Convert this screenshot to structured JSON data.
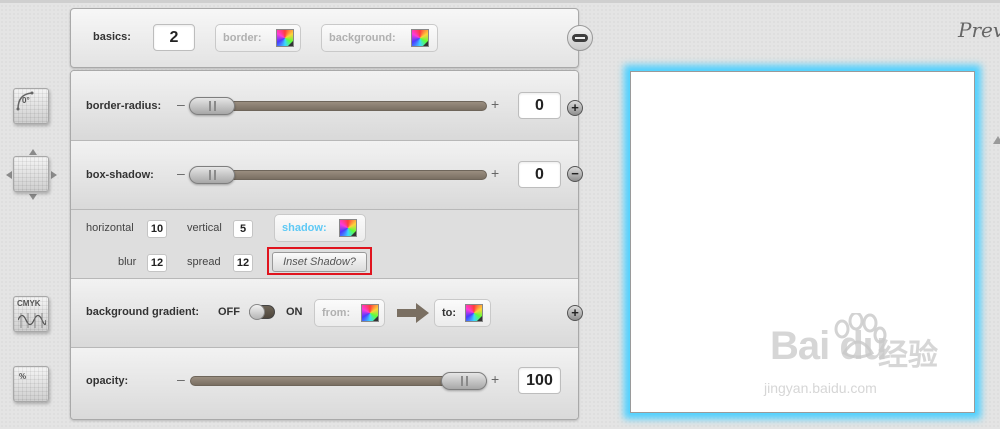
{
  "basics": {
    "label": "basics:",
    "value": "2",
    "border_label": "border:",
    "background_label": "background:"
  },
  "border_radius": {
    "label": "border-radius:",
    "minus": "–",
    "plus": "+",
    "value": "0",
    "slider_level": 0
  },
  "box_shadow": {
    "label": "box-shadow:",
    "minus": "–",
    "plus": "+",
    "value": "0",
    "slider_level": 0
  },
  "shadow_options": {
    "horizontal_label": "horizontal",
    "horizontal_value": "10",
    "vertical_label": "vertical",
    "vertical_value": "5",
    "shadow_label": "shadow:",
    "blur_label": "blur",
    "blur_value": "12",
    "spread_label": "spread",
    "spread_value": "12",
    "inset_button": "Inset Shadow?"
  },
  "background_gradient": {
    "label": "background gradient:",
    "off_label": "OFF",
    "on_label": "ON",
    "from_label": "from:",
    "to_label": "to:"
  },
  "opacity": {
    "label": "opacity:",
    "minus": "–",
    "plus": "+",
    "value": "100",
    "slider_level": 100
  },
  "tools": {
    "radius_tool_label": "0°",
    "cmyk_tool_label": "CMYK",
    "opacity_tool_label": "%"
  },
  "preview": {
    "title": "Preview"
  },
  "watermark": {
    "brand": "Bai du",
    "brand_cn": "经验",
    "url": "jingyan.baidu.com"
  },
  "colors": {
    "glow": "#4fd0ff",
    "shadow_label": "#5ec9f5",
    "highlight": "#e0141e",
    "slider_track": "#8a7e70"
  }
}
